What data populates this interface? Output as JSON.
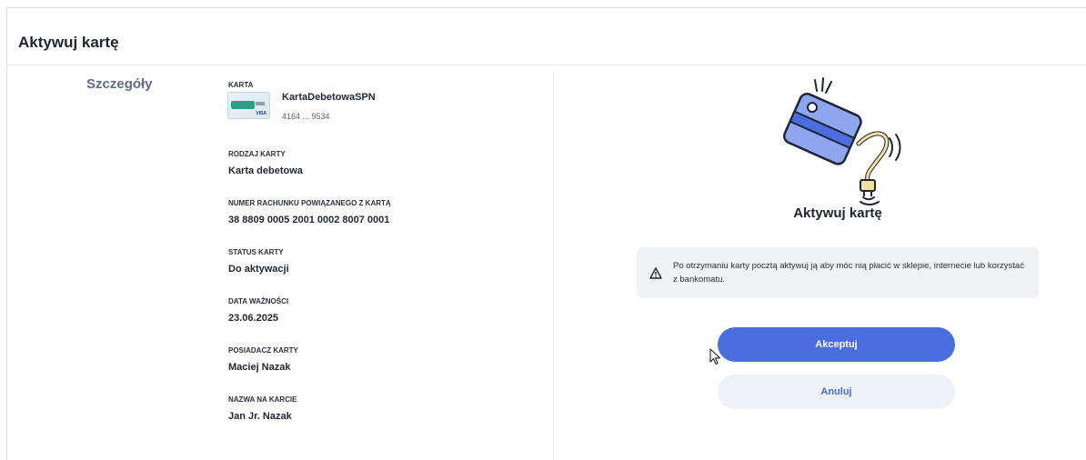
{
  "page": {
    "title": "Aktywuj kartę",
    "section": "Szczegóły"
  },
  "card": {
    "label": "KARTA",
    "name": "KartaDebetowaSPN",
    "number": "4164 ... 9534",
    "thumb_brand": "VISA"
  },
  "details": [
    {
      "label": "RODZAJ KARTY",
      "value": "Karta debetowa"
    },
    {
      "label": "NUMER RACHUNKU POWIĄZANEGO Z KARTĄ",
      "value": "38 8809 0005 2001 0002 8007 0001"
    },
    {
      "label": "STATUS KARTY",
      "value": "Do aktywacji"
    },
    {
      "label": "DATA WAŻNOŚCI",
      "value": "23.06.2025"
    },
    {
      "label": "POSIADACZ KARTY",
      "value": "Maciej Nazak"
    },
    {
      "label": "NAZWA NA KARCIE",
      "value": "Jan Jr. Nazak"
    }
  ],
  "activation": {
    "heading": "Aktywuj kartę",
    "notice": "Po otrzymaniu karty pocztą aktywuj ją aby móc nią płacić w sklepie, internecie lub korzystać z bankomatu.",
    "accept_label": "Akceptuj",
    "cancel_label": "Anuluj"
  },
  "colors": {
    "primary": "#4a6ee0",
    "section_label": "#5f6b8a",
    "notice_bg": "#f0f1f3"
  },
  "icons": [
    "card-activation-illustration",
    "warning-icon",
    "mouse-cursor-icon"
  ]
}
